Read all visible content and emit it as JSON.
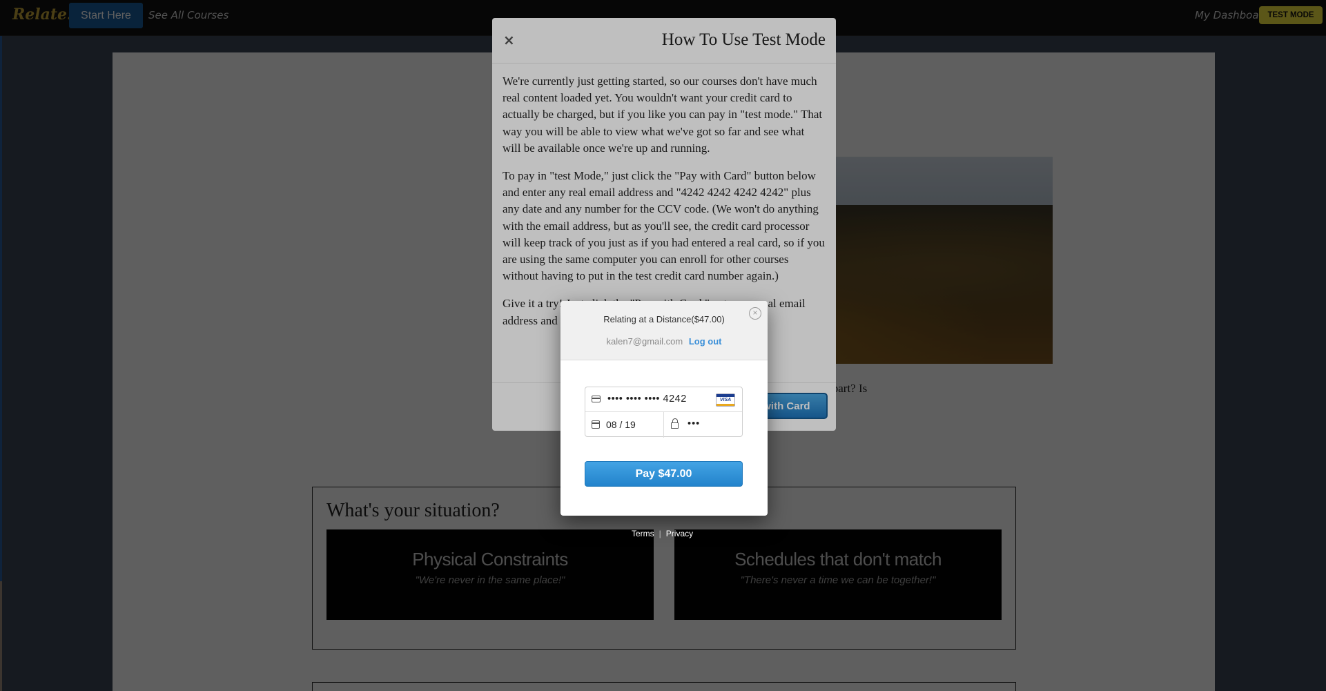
{
  "navbar": {
    "brand": "Relate!",
    "start_here": "Start Here",
    "see_all_courses": "See All Courses",
    "my_dashboard": "My Dashboard",
    "test_mode_badge": "TEST MODE"
  },
  "page": {
    "hero_caption": "How can you make your relationship work when you're living far apart? Is",
    "situation_title": "What's your situation?",
    "cards": [
      {
        "title": "Physical Constraints",
        "quote": "\"We're never in the same place!\""
      },
      {
        "title": "Schedules that don't match",
        "quote": "\"There's never a time we can be together!\""
      }
    ]
  },
  "test_modal": {
    "close": "×",
    "title": "How To Use Test Mode",
    "paragraphs": [
      "We're currently just getting started, so our courses don't have much real content loaded yet. You wouldn't want your credit card to actually be charged, but if you like you can pay in \"test mode.\" That way you will be able to view what we've got so far and see what will be available once we're up and running.",
      "To pay in \"test Mode,\" just click the \"Pay with Card\" button below and enter any real email address and \"4242 4242 4242 4242\" plus any date and any number for the CCV code. (We won't do anything with the email address, but as you'll see, the credit card processor will keep track of you just as if you had entered a real card, so if you are using the same computer you can enroll for other courses without having to put in the test credit card number again.)",
      "Give it a try! Just click the \"Pay with Card,\" enter any real email address and any other number for the CCV code."
    ],
    "pay_with_card": "Pay with Card"
  },
  "checkout": {
    "close": "×",
    "title": "Relating at a Distance($47.00)",
    "email": "kalen7@gmail.com",
    "logout": "Log out",
    "card_number": "•••• •••• •••• 4242",
    "card_brand": "VISA",
    "expiry": "08 / 19",
    "cvc": "•••",
    "pay_button": "Pay $47.00"
  },
  "legal": {
    "terms": "Terms",
    "separator": "|",
    "privacy": "Privacy"
  },
  "colors": {
    "navbar_bg": "#111111",
    "start_here_bg": "#1b5f9f",
    "test_badge_bg": "#f4e640",
    "pay_button_bg": "#2283cc",
    "link_blue": "#3a8fd8"
  }
}
